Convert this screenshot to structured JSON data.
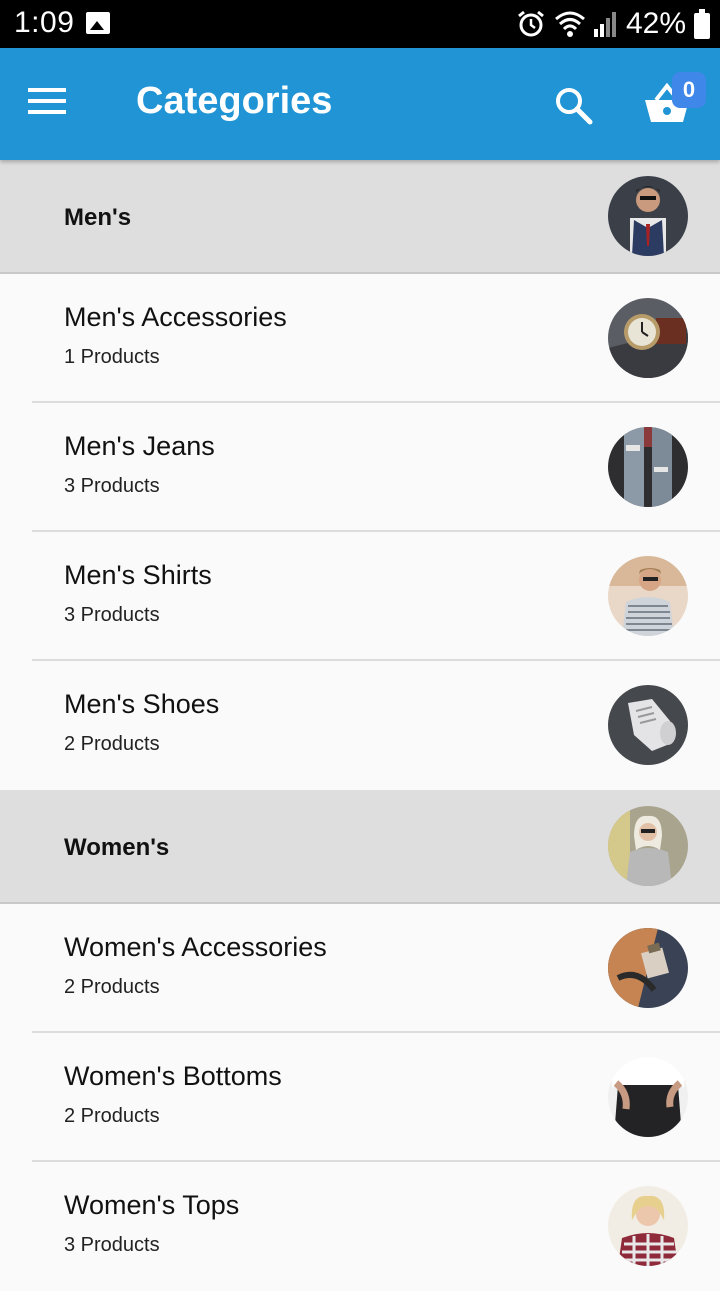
{
  "status": {
    "time": "1:09",
    "battery": "42%"
  },
  "app_bar": {
    "title": "Categories",
    "cart_count": "0"
  },
  "colors": {
    "app_bar": "#2094d4",
    "badge": "#3f87e8",
    "section_bg": "#dedede"
  },
  "sections": [
    {
      "label": "Men's",
      "items": [
        {
          "name": "Men's Accessories",
          "count": "1 Products"
        },
        {
          "name": "Men's Jeans",
          "count": "3 Products"
        },
        {
          "name": "Men's Shirts",
          "count": "3 Products"
        },
        {
          "name": "Men's Shoes",
          "count": "2 Products"
        }
      ]
    },
    {
      "label": "Women's",
      "items": [
        {
          "name": "Women's Accessories",
          "count": "2 Products"
        },
        {
          "name": "Women's Bottoms",
          "count": "2 Products"
        },
        {
          "name": "Women's Tops",
          "count": "3 Products"
        }
      ]
    }
  ]
}
